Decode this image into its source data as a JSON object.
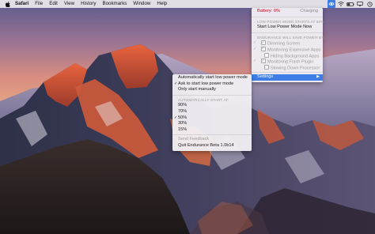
{
  "menubar": {
    "apple_icon": "apple-logo",
    "app_name": "Safari",
    "items": [
      "File",
      "Edit",
      "View",
      "History",
      "Bookmarks",
      "Window",
      "Help"
    ],
    "tray_icons": [
      "endurance-icon",
      "wifi-icon",
      "battery-icon",
      "display-icon",
      "clock-icon"
    ]
  },
  "endurance_menu": {
    "battery_label": "Battery: 0%",
    "status": "Charging",
    "low_power_header": "LOW POWER MODE STARTS AT 50%",
    "start_now": "Start Low Power Mode Now",
    "saving_header": "ENDURANCE WILL SAVE POWER BY:",
    "options": [
      {
        "label": "Dimming Screen",
        "checked": true,
        "indent": 1
      },
      {
        "label": "Monitoring Expensive Apps",
        "checked": true,
        "indent": 1
      },
      {
        "label": "Hiding Background Apps",
        "checked": false,
        "indent": 2
      },
      {
        "label": "Monitoring Flash Plugin",
        "checked": true,
        "indent": 1
      },
      {
        "label": "Slowing Down Processor",
        "checked": false,
        "indent": 2
      }
    ],
    "settings_label": "Settings"
  },
  "settings_submenu": {
    "mode_items": [
      {
        "label": "Automatically start low power mode",
        "checked": false
      },
      {
        "label": "Ask to start low power mode",
        "checked": true
      },
      {
        "label": "Only start manually",
        "checked": false
      }
    ],
    "auto_start_header": "AUTOMATICALLY START AT:",
    "thresholds": [
      {
        "label": "90%",
        "checked": false
      },
      {
        "label": "70%",
        "checked": false
      },
      {
        "label": "50%",
        "checked": true
      },
      {
        "label": "30%",
        "checked": false
      },
      {
        "label": "15%",
        "checked": false
      }
    ],
    "feedback_label": "Send Feedback",
    "quit_label": "Quit Endurance Beta 1.0b14"
  },
  "colors": {
    "accent": "#3c7ee6",
    "warning_red": "#d0021b"
  }
}
